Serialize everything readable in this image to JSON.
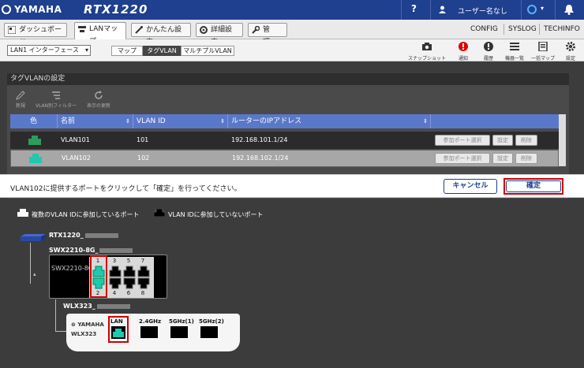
{
  "header": {
    "brand": "YAMAHA",
    "model": "RTX1220",
    "help": "?",
    "user": "ユーザー名なし"
  },
  "tabs": [
    {
      "label": "ダッシュボード"
    },
    {
      "label": "LANマップ"
    },
    {
      "label": "かんたん設定"
    },
    {
      "label": "詳細設定"
    },
    {
      "label": "管　理"
    }
  ],
  "toplinks": {
    "config": "CONFIG",
    "syslog": "SYSLOG",
    "techinfo": "TECHINFO"
  },
  "subbar": {
    "interface": "LAN1 インターフェース",
    "views": [
      "マップ",
      "タグVLAN",
      "マルチプルVLAN"
    ],
    "tools": [
      "スナップショット",
      "通知",
      "履歴",
      "機器一覧",
      "一括マップ",
      "設定"
    ]
  },
  "panel": {
    "title": "タグVLANの設定",
    "tools": [
      "新規",
      "VLAN別フィルター",
      "表示の更新"
    ]
  },
  "table": {
    "headers": [
      "色",
      "名前",
      "VLAN ID",
      "ルーターのIPアドレス"
    ],
    "rows": [
      {
        "name": "VLAN101",
        "id": "101",
        "ip": "192.168.101.1/24",
        "color": "#2e9b5a"
      },
      {
        "name": "VLAN102",
        "id": "102",
        "ip": "192.168.102.1/24",
        "color": "#1ec9b0"
      }
    ],
    "row_buttons": [
      "参加ポート選択",
      "設定",
      "削除"
    ]
  },
  "message": "VLAN102に提供するポートをクリックして「確定」を行ってください。",
  "cancel": "キャンセル",
  "ok": "確定",
  "legend": {
    "participating": "複数のVLAN IDに参加しているポート",
    "not_participating": "VLAN IDに参加していないポート"
  },
  "map": {
    "router": "RTX1220_",
    "switch_label": "SWX2210-8G_",
    "switch_model": "SWX2210-8G",
    "ports_top": [
      "1",
      "3",
      "5",
      "7"
    ],
    "ports_bottom": [
      "2",
      "4",
      "6",
      "8"
    ],
    "ap_label": "WLX323_",
    "ap_brand": "YAMAHA",
    "ap_model": "WLX323",
    "ap_ports": [
      "LAN",
      "2.4GHz",
      "5GHz(1)",
      "5GHz(2)"
    ]
  }
}
